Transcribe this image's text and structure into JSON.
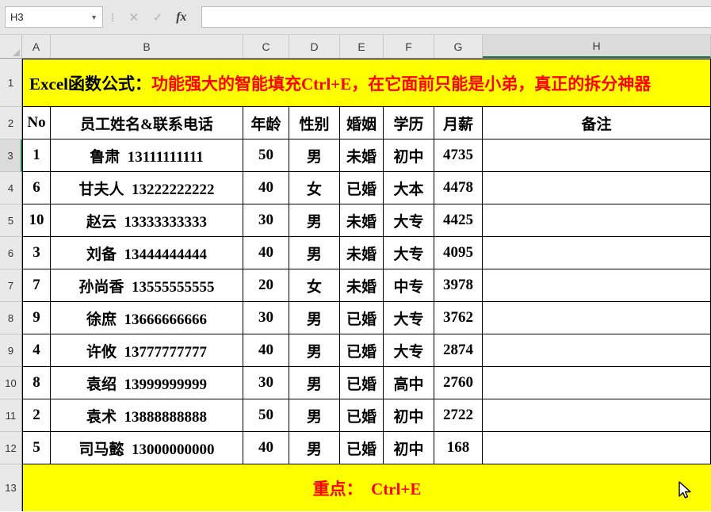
{
  "toolbar": {
    "name_box_value": "H3",
    "cancel_label": "✕",
    "enter_label": "✓",
    "fx_label": "fx",
    "formula_value": ""
  },
  "grid": {
    "column_letters": [
      "A",
      "B",
      "C",
      "D",
      "E",
      "F",
      "G",
      "H"
    ],
    "row_numbers": [
      "1",
      "2",
      "3",
      "4",
      "5",
      "6",
      "7",
      "8",
      "9",
      "10",
      "11",
      "12",
      "13"
    ]
  },
  "banner": {
    "black_text": "Excel函数公式：",
    "red_text": "功能强大的智能填充Ctrl+E，在它面前只能是小弟，真正的拆分神器"
  },
  "table": {
    "headers": [
      "No",
      "员工姓名&联系电话",
      "年龄",
      "性别",
      "婚姻",
      "学历",
      "月薪",
      "备注"
    ],
    "rows": [
      [
        "1",
        "鲁肃  13111111111",
        "50",
        "男",
        "未婚",
        "初中",
        "4735",
        ""
      ],
      [
        "6",
        "甘夫人  13222222222",
        "40",
        "女",
        "已婚",
        "大本",
        "4478",
        ""
      ],
      [
        "10",
        "赵云  13333333333",
        "30",
        "男",
        "未婚",
        "大专",
        "4425",
        ""
      ],
      [
        "3",
        "刘备  13444444444",
        "40",
        "男",
        "未婚",
        "大专",
        "4095",
        ""
      ],
      [
        "7",
        "孙尚香  13555555555",
        "20",
        "女",
        "未婚",
        "中专",
        "3978",
        ""
      ],
      [
        "9",
        "徐庶  13666666666",
        "30",
        "男",
        "已婚",
        "大专",
        "3762",
        ""
      ],
      [
        "4",
        "许攸  13777777777",
        "40",
        "男",
        "已婚",
        "大专",
        "2874",
        ""
      ],
      [
        "8",
        "袁绍  13999999999",
        "30",
        "男",
        "已婚",
        "高中",
        "2760",
        ""
      ],
      [
        "2",
        "袁术  13888888888",
        "50",
        "男",
        "已婚",
        "初中",
        "2722",
        ""
      ],
      [
        "5",
        "司马懿  13000000000",
        "40",
        "男",
        "已婚",
        "初中",
        "168",
        ""
      ]
    ]
  },
  "footer": {
    "red_text": "重点：  Ctrl+E"
  },
  "colors": {
    "highlight_yellow": "#FFFF00",
    "accent_red": "#FF0000",
    "selection_green": "#217346"
  }
}
